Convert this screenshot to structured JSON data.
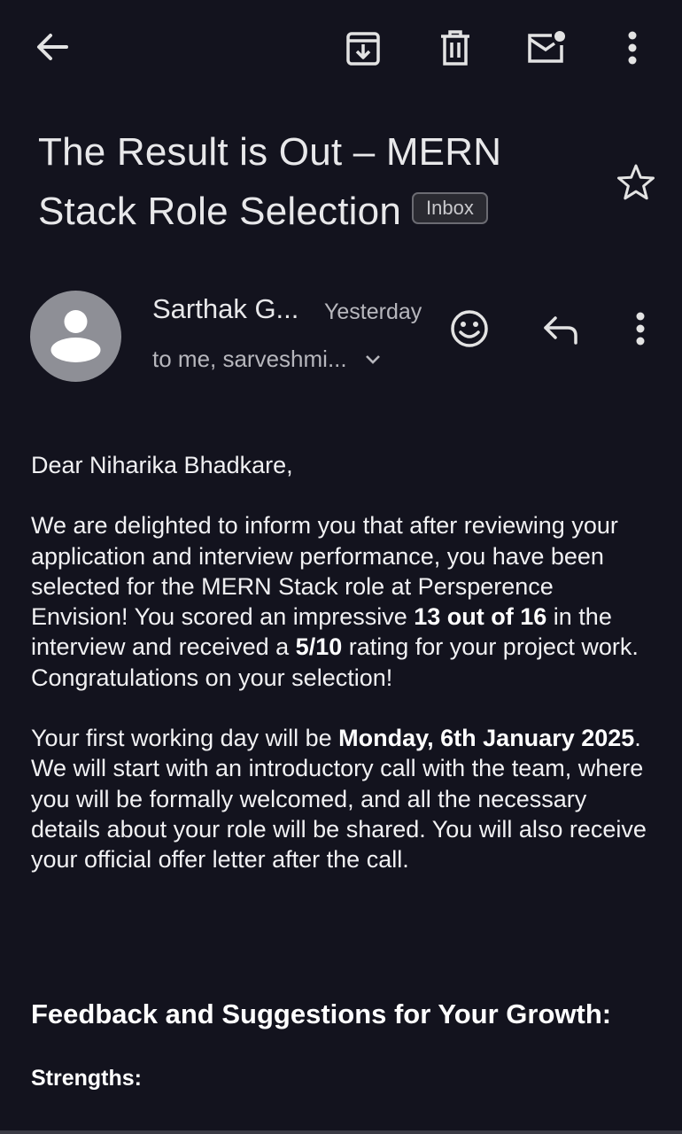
{
  "toolbar": {
    "back_icon": "arrow-left-icon",
    "archive_icon": "archive-icon",
    "delete_icon": "trash-icon",
    "mark_unread_icon": "mail-unread-icon",
    "more_icon": "more-vert-icon"
  },
  "email": {
    "subject_line1": "The Result is Out – MERN",
    "subject_line2": "Stack Role Selection",
    "label_chip": "Inbox",
    "sender": "Sarthak G...",
    "date": "Yesterday",
    "recipients": "to me, sarveshmi...",
    "greeting": "Dear Niharika Bhadkare,",
    "p1_a": "We are delighted to inform you that after reviewing your application and interview performance, you have been selected for the MERN Stack role at Persperence Envision! You scored an impressive ",
    "p1_b": "13 out of 16",
    "p1_c": " in the interview and received a ",
    "p1_d": "5/10",
    "p1_e": " rating for your project work. Congratulations on your selection!",
    "p2_a": "Your first working day will be ",
    "p2_b": "Monday, 6th January 2025",
    "p2_c": ". We will start with an introductory call with the team, where you will be formally welcomed, and all the necessary details about your role will be shared. You will also receive your official offer letter after the call.",
    "heading": "Feedback and Suggestions for Your Growth:",
    "subheading": "Strengths:"
  },
  "colors": {
    "background": "#13131e",
    "text_primary": "#f1f1f3",
    "text_secondary": "#b7b7bd",
    "avatar_bg": "#8e8f96"
  }
}
